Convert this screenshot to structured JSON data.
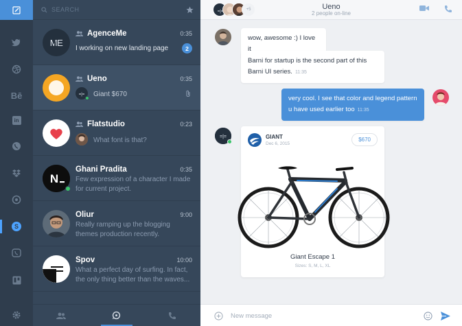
{
  "colors": {
    "accent": "#4a90d9",
    "rail_bg": "#2f3d4d",
    "list_bg": "#36475a",
    "online": "#3bc46a"
  },
  "rail": {
    "items": [
      {
        "icon": "twitter-icon",
        "glyph": ""
      },
      {
        "icon": "dribbble-icon",
        "glyph": ""
      },
      {
        "icon": "behance-icon",
        "glyph": "Bē"
      },
      {
        "icon": "linkedin-icon",
        "glyph": "in"
      },
      {
        "icon": "whatsapp-icon",
        "glyph": ""
      },
      {
        "icon": "dropbox-icon",
        "glyph": ""
      },
      {
        "icon": "chat-app-icon",
        "glyph": ""
      },
      {
        "icon": "skype-icon",
        "glyph": "S"
      },
      {
        "icon": "viber-icon",
        "glyph": ""
      },
      {
        "icon": "trello-icon",
        "glyph": ""
      }
    ]
  },
  "search": {
    "placeholder": "SEARCH"
  },
  "conversations": [
    {
      "name": "AgenceMe",
      "time": "0:35",
      "message": "I working on new landing page",
      "badge": "2",
      "group": true
    },
    {
      "name": "Ueno",
      "time": "0:35",
      "message": "Giant $670",
      "group": true
    },
    {
      "name": "Flatstudio",
      "time": "0:23",
      "message": "What font is that?",
      "group": true
    },
    {
      "name": "Ghani Pradita",
      "time": "0:35",
      "message": "Few expression of a character I made for current project."
    },
    {
      "name": "Oliur",
      "time": "9:00",
      "message": "Really ramping up the blogging themes production recently."
    },
    {
      "name": "Spov",
      "time": "10:00",
      "message": "What a perfect day of surfing. In fact, the only thing better than the waves..."
    }
  ],
  "chat": {
    "title": "Ueno",
    "subtitle": "2 people on-line",
    "extra_members": "+5",
    "messages": [
      {
        "text": "wow, awesome :) I love it",
        "time": ""
      },
      {
        "text": "Barni for startup is the second part of this Barni UI series.",
        "time": "11:35"
      },
      {
        "text": "very cool. I see that color and legend pattern u have used earlier too",
        "time": "11:35"
      }
    ],
    "product": {
      "brand": "GIANT",
      "date": "Dec 6, 2015",
      "price": "$670",
      "name": "Giant Escape 1",
      "sizes": "Sizes: S, M, L, XL"
    },
    "composer_placeholder": "New message"
  }
}
